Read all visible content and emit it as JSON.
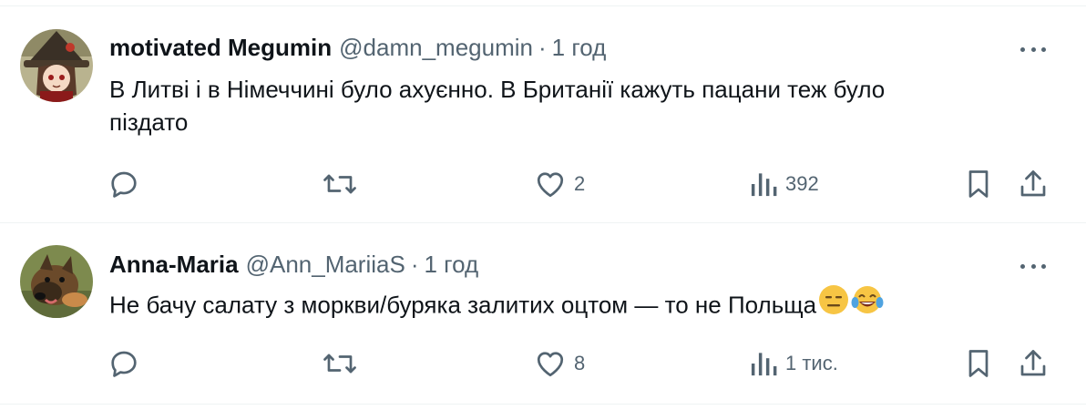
{
  "tweets": [
    {
      "name": "motivated Megumin",
      "handle": "@damn_megumin",
      "separator": "·",
      "time": "1 год",
      "text_line1": "В Литві і в Німеччині було ахуєнно. В Британії кажуть пацани теж було",
      "text_line2": "піздато",
      "likes": "2",
      "views": "392",
      "avatar": "anime-witch-avatar"
    },
    {
      "name": "Anna-Maria",
      "handle": "@Ann_MariiaS",
      "separator": "·",
      "time": "1 год",
      "text": "Не бачу салату з моркви/буряка залитих оцтом — то не Польща",
      "emojis": [
        "expressionless-face",
        "tears-of-joy-face"
      ],
      "likes": "8",
      "views": "1 тис.",
      "avatar": "dog-avatar"
    }
  ],
  "icons": {
    "reply": "reply-icon",
    "retweet": "retweet-icon",
    "like": "heart-icon",
    "views": "views-chart-icon",
    "bookmark": "bookmark-icon",
    "share": "share-icon",
    "more": "more-icon"
  },
  "colors": {
    "text": "#0f1419",
    "secondary": "#536471",
    "divider": "#eff3f4"
  }
}
